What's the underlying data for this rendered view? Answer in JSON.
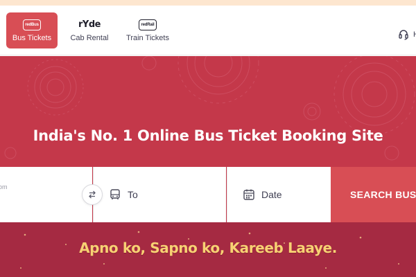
{
  "nav": {
    "items": [
      {
        "label": "Bus Tickets",
        "icon": "redbus-logo-icon",
        "logo_text": "redBus",
        "active": true
      },
      {
        "label": "Cab Rental",
        "icon": "ryde-logo-icon",
        "logo_text": "rYde",
        "active": false
      },
      {
        "label": "Train Tickets",
        "icon": "redrail-logo-icon",
        "logo_text": "redRail",
        "active": false
      }
    ],
    "help_label": "H"
  },
  "hero": {
    "title": "India's No. 1 Online Bus Ticket Booking Site",
    "tagline": "Apno ko, Sapno ko, Kareeb Laaye."
  },
  "search": {
    "from_placeholder": "om",
    "to_placeholder": "To",
    "date_placeholder": "Date",
    "button_label": "SEARCH BUSES"
  },
  "colors": {
    "brand_red": "#d84e55",
    "hero_bg": "#c4384a",
    "promo_bg": "#a52a42",
    "tagline": "#f7d173",
    "top_strip": "#fde6cf"
  }
}
